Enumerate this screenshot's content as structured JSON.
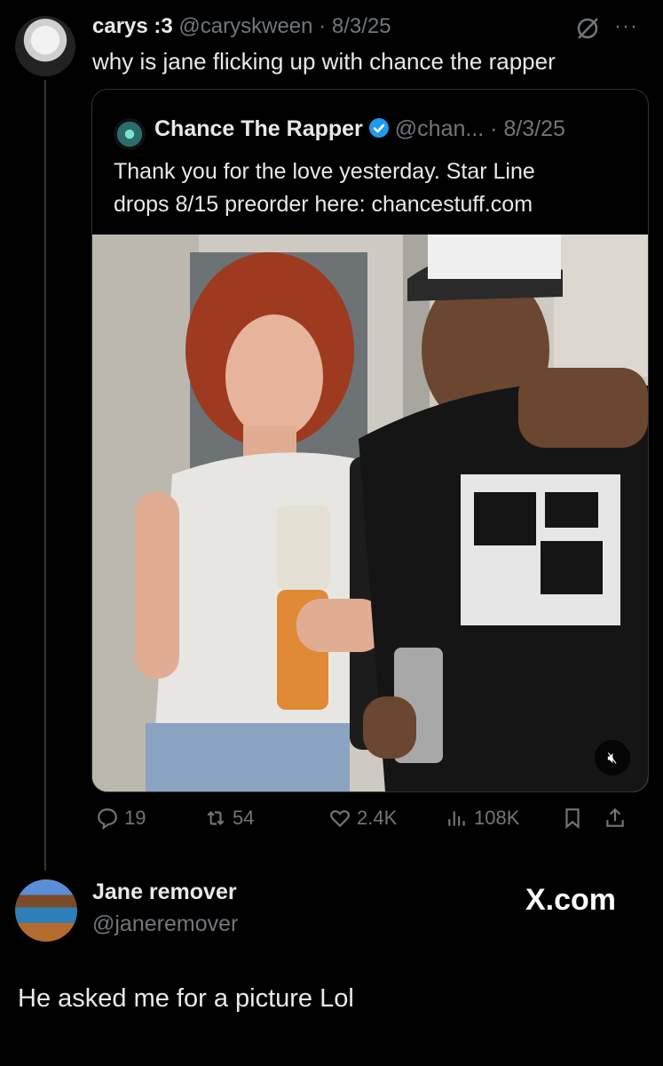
{
  "tweet": {
    "author_name": "carys :3",
    "author_handle": "@caryskween",
    "separator": "·",
    "date": "8/3/25",
    "more_label": "···",
    "text": "why is jane flicking up with chance the rapper"
  },
  "quote": {
    "author_name": "Chance The Rapper",
    "author_handle": "@chan...",
    "separator": "·",
    "date": "8/3/25",
    "text_lines": [
      "Thank you for the love yesterday. Star Line",
      "drops 8/15 preorder here: chancestuff.com"
    ],
    "media_mute_icon": "speaker-muted-icon"
  },
  "actions": {
    "replies": "19",
    "reposts": "54",
    "likes": "2.4K",
    "views": "108K"
  },
  "reply": {
    "author_name": "Jane remover",
    "author_handle": "@janeremover",
    "text": "He asked me for a picture Lol"
  },
  "watermark": "X.com",
  "colors": {
    "background": "#000000",
    "text": "#e7e9ea",
    "muted": "#71767b",
    "verified": "#1d9bf0",
    "border": "#2f3336"
  }
}
